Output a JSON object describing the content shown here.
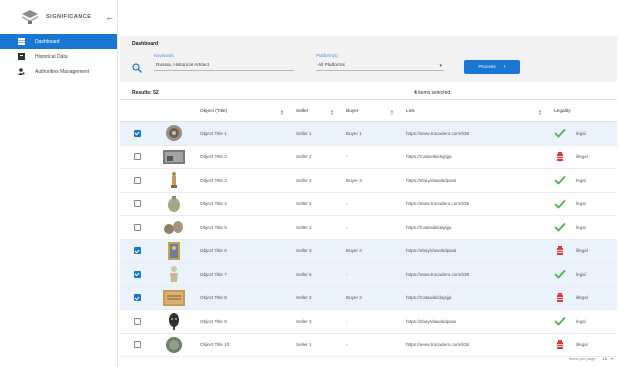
{
  "sidebar": {
    "brand": "SIGNIFICANCE",
    "items": [
      {
        "label": "Dashboard",
        "icon": "dashboard-icon",
        "active": true
      },
      {
        "label": "Historical Data",
        "icon": "history-book-icon",
        "active": false
      },
      {
        "label": "Authorities Management",
        "icon": "user-gear-icon",
        "active": false
      }
    ]
  },
  "filter": {
    "title": "Dashboard",
    "keywords_label": "Keywords",
    "keywords_value": "Russia, Historical Artifact",
    "platform_label": "Platform(s)",
    "platform_value": "All Platforms",
    "process_label": "Process"
  },
  "results": {
    "label": "Results: 52",
    "selected_count": "4",
    "selected_text": "items selected"
  },
  "table": {
    "headers": {
      "object": "Object (Title)",
      "seller": "Seller",
      "buyer": "Buyer",
      "link": "Link",
      "legality": "Legality"
    },
    "rows": [
      {
        "checked": true,
        "thumb": "plate",
        "object": "Object Title 1",
        "seller": "Seller 1",
        "buyer": "Buyer 1",
        "link": "https://www.trocadero.com/638",
        "legality": "legal"
      },
      {
        "checked": false,
        "thumb": "painting",
        "object": "Object Title 2",
        "seller": "Seller 2",
        "buyer": "-",
        "link": "https://Catawiki/dajsjja",
        "legality": "illegal"
      },
      {
        "checked": false,
        "thumb": "statue",
        "object": "Object Title 3",
        "seller": "Seller 3",
        "buyer": "Buyer 3",
        "link": "https://ebay/dawokdpawi",
        "legality": "legal"
      },
      {
        "checked": false,
        "thumb": "vase",
        "object": "Object Title 4",
        "seller": "Seller 4",
        "buyer": "-",
        "link": "https://www.trocadero.com/638",
        "legality": "legal"
      },
      {
        "checked": false,
        "thumb": "vessels",
        "object": "Object Title 5",
        "seller": "Seller 2",
        "buyer": "-",
        "link": "https://Catawiki/dajsjja",
        "legality": "legal"
      },
      {
        "checked": true,
        "thumb": "icon",
        "object": "Object Title 6",
        "seller": "Seller 3",
        "buyer": "Buyer 3",
        "link": "https://ebay/dawokdpawi",
        "legality": "illegal"
      },
      {
        "checked": true,
        "thumb": "figurine",
        "object": "Object Title 7",
        "seller": "Seller 5",
        "buyer": "-",
        "link": "https://www.trocadero.com/638",
        "legality": "legal"
      },
      {
        "checked": true,
        "thumb": "manuscript",
        "object": "Object Title 8",
        "seller": "Seller 2",
        "buyer": "Buyer 2",
        "link": "https://Catawiki/dajsjja",
        "legality": "illegal"
      },
      {
        "checked": false,
        "thumb": "mask",
        "object": "Object Title 9",
        "seller": "Seller 3",
        "buyer": "-",
        "link": "https://ebay/dawokdpawi",
        "legality": "legal"
      },
      {
        "checked": false,
        "thumb": "coin",
        "object": "Object Title 10",
        "seller": "Seller 1",
        "buyer": "-",
        "link": "https://www.trocadero.com/638",
        "legality": "illegal"
      }
    ]
  },
  "pagination": {
    "label": "Items per page:",
    "value": "10"
  },
  "colors": {
    "accent": "#1976d2",
    "legal": "#4caf50",
    "illegal": "#e53935"
  }
}
